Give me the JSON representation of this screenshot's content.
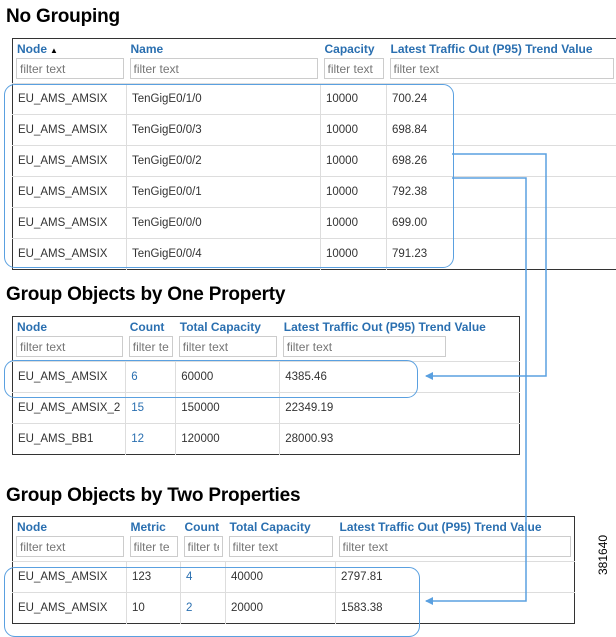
{
  "sections": [
    {
      "title": "No Grouping",
      "columns": [
        "Node",
        "Name",
        "Capacity",
        "Latest Traffic Out (P95) Trend Value"
      ],
      "filter_placeholders": [
        "filter text",
        "filter text",
        "filter text",
        "filter text"
      ],
      "rows": [
        [
          "EU_AMS_AMSIX",
          "TenGigE0/1/0",
          "10000",
          "700.24"
        ],
        [
          "EU_AMS_AMSIX",
          "TenGigE0/0/3",
          "10000",
          "698.84"
        ],
        [
          "EU_AMS_AMSIX",
          "TenGigE0/0/2",
          "10000",
          "698.26"
        ],
        [
          "EU_AMS_AMSIX",
          "TenGigE0/0/1",
          "10000",
          "792.38"
        ],
        [
          "EU_AMS_AMSIX",
          "TenGigE0/0/0",
          "10000",
          "699.00"
        ],
        [
          "EU_AMS_AMSIX",
          "TenGigE0/0/4",
          "10000",
          "791.23"
        ]
      ]
    },
    {
      "title": "Group Objects by One Property",
      "columns": [
        "Node",
        "Count",
        "Total Capacity",
        "Latest Traffic Out (P95) Trend Value"
      ],
      "filter_placeholders": [
        "filter text",
        "filter te",
        "filter text",
        "filter text"
      ],
      "rows": [
        [
          "EU_AMS_AMSIX",
          "6",
          "60000",
          "4385.46"
        ],
        [
          "EU_AMS_AMSIX_2",
          "15",
          "150000",
          "22349.19"
        ],
        [
          "EU_AMS_BB1",
          "12",
          "120000",
          "28000.93"
        ]
      ]
    },
    {
      "title": "Group Objects by Two Properties",
      "columns": [
        "Node",
        "Metric",
        "Count",
        "Total Capacity",
        "Latest Traffic Out (P95) Trend Value"
      ],
      "filter_placeholders": [
        "filter text",
        "filter te",
        "filter te",
        "filter text",
        "filter text"
      ],
      "rows": [
        [
          "EU_AMS_AMSIX",
          "123",
          "4",
          "40000",
          "2797.81"
        ],
        [
          "EU_AMS_AMSIX",
          "10",
          "2",
          "20000",
          "1583.38"
        ]
      ]
    }
  ],
  "figure_id": "381640",
  "colors": {
    "header_text": "#2a6fb0",
    "highlight": "#5aa0e0",
    "link_count": "#2a6fb0"
  }
}
